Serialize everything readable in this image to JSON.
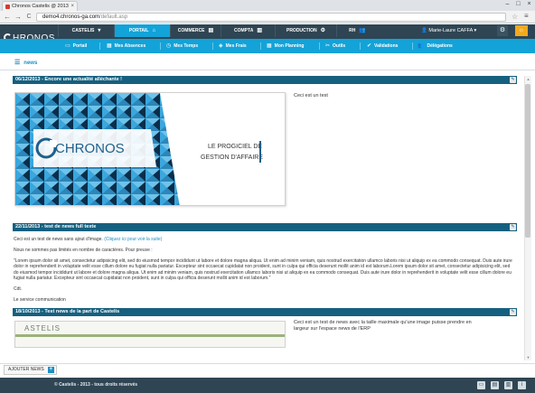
{
  "browser": {
    "tab_title": "Chronos Castelis @ 2013",
    "tab_close": "×",
    "back": "←",
    "forward": "→",
    "reload": "C",
    "url_host": "demo4.chronos-ga.com",
    "url_path": "/default.asp",
    "star": "☆",
    "menu": "≡",
    "win_min": "–",
    "win_max": "□",
    "win_close": "×"
  },
  "app": {
    "logo_text": "HRONOS",
    "top_nav": [
      {
        "label": "CASTELIS",
        "icon": "▾"
      },
      {
        "label": "PORTAIL",
        "icon": "⌂"
      },
      {
        "label": "COMMERCE",
        "icon": "▤"
      },
      {
        "label": "COMPTA",
        "icon": "▥"
      },
      {
        "label": "PRODUCTION",
        "icon": "⚙"
      },
      {
        "label": "RH",
        "icon": "👥"
      }
    ],
    "user": {
      "icon": "👤",
      "name": "Marie-Laure CAFFA",
      "caret": "▾"
    },
    "gear_icon": "⚙",
    "sun_icon": "☼",
    "sub_nav": [
      {
        "label": "Portail",
        "icon": "▭"
      },
      {
        "label": "Mes Absences",
        "icon": "▦"
      },
      {
        "label": "Mes Temps",
        "icon": "◷"
      },
      {
        "label": "Mes Frais",
        "icon": "◈"
      },
      {
        "label": "Mon Planning",
        "icon": "▦"
      },
      {
        "label": "Outils",
        "icon": "✂"
      },
      {
        "label": "Validations",
        "icon": "✔"
      },
      {
        "label": "Délégations",
        "icon": "👥"
      }
    ]
  },
  "page_tab": {
    "icon": "☰",
    "label": "news"
  },
  "news": [
    {
      "title": "06/12/2013 - Encore une actualité alléchante !",
      "caption": "Ceci est un test",
      "image_logo": "CHRONOS",
      "image_tagline_1": "LE PROGICIEL DE",
      "image_tagline_2": "GESTION D'AFFAIRE"
    },
    {
      "title": "22/11/2013 - test de news full texte",
      "intro": "Ceci est un test de news sans ajout d'image.",
      "intro_link": "(Cliquez ici pour voir la suite)",
      "p2": "Nous ne sommes pas limités en nombre de caractères. Pour preuve :",
      "p3": "\"Lorem ipsum dolor sit amet, consectetur adipisicing elit, sed do eiusmod tempor incididunt ut labore et dolore magna aliqua. Ut enim ad minim veniam, quis nostrud exercitation ullamco laboris nisi ut aliquip ex ea commodo consequat. Duis aute irure dolor in reprehenderit in voluptate velit esse cillum dolore eu fugiat nulla pariatur. Excepteur sint occaecat cupidatat non proident, sunt in culpa qui officia deserunt mollit anim id est laborum.Lorem ipsum dolor sit amet, consectetur adipisicing elit, sed do eiusmod tempor incididunt ut labore et dolore magna aliqua. Ut enim ad minim veniam, quis nostrud exercitation ullamco laboris nisi ut aliquip ex ea commodo consequat. Duis aute irure dolor in reprehenderit in voluptate velit esse cillum dolore eu fugiat nulla pariatur. Excepteur sint occaecat cupidatat non proident, sunt in culpa qui officia deserunt mollit anim id est laborum.\"",
      "p4": "Cdt.",
      "p5": "Le service communication"
    },
    {
      "title": "18/10/2013 - Test news de la part de Castelis",
      "image_logo": "ASTELIS",
      "text": "Ceci est un test de news avec la taille maximale qu'une image puisse prendre en largeur sur l'espace news de l'ERP"
    }
  ],
  "edit_icon": "✎",
  "add_news": {
    "label": "AJOUTER NEWS",
    "plus": "+"
  },
  "footer": {
    "text": "© Castelis - 2013 - tous droits réservés",
    "icons": [
      "▭",
      "▤",
      "▥",
      "i"
    ]
  },
  "scrollbar": {
    "up": "▲",
    "down": "▼"
  },
  "colors": {
    "header_dark": "#2f4553",
    "accent_blue": "#13a3d8",
    "news_header": "#16607f",
    "orange": "#f3a91d"
  }
}
